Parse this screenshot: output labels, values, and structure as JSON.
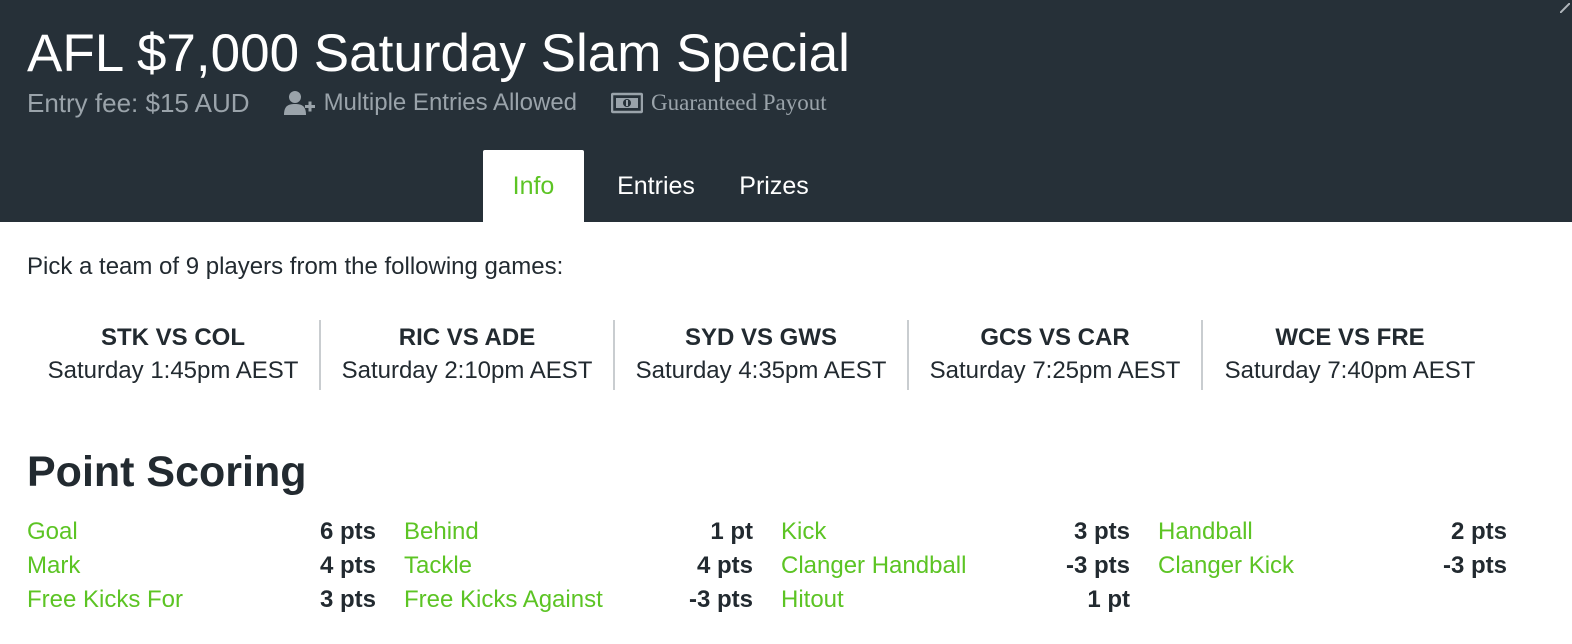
{
  "header": {
    "title": "AFL $7,000 Saturday Slam Special",
    "entry_fee": "Entry fee: $15 AUD",
    "multiple_entries": "Multiple Entries Allowed",
    "guaranteed_payout": "Guaranteed Payout",
    "icons": {
      "multiple_entries": "user-plus-icon",
      "guaranteed_payout": "money-bill-icon"
    }
  },
  "tabs": [
    {
      "label": "Info",
      "active": true
    },
    {
      "label": "Entries",
      "active": false
    },
    {
      "label": "Prizes",
      "active": false
    }
  ],
  "intro_text": "Pick a team of 9 players from the following games:",
  "games": [
    {
      "matchup": "STK VS COL",
      "time": "Saturday 1:45pm AEST"
    },
    {
      "matchup": "RIC VS ADE",
      "time": "Saturday 2:10pm AEST"
    },
    {
      "matchup": "SYD VS GWS",
      "time": "Saturday 4:35pm AEST"
    },
    {
      "matchup": "GCS VS CAR",
      "time": "Saturday 7:25pm AEST"
    },
    {
      "matchup": "WCE VS FRE",
      "time": "Saturday 7:40pm AEST"
    }
  ],
  "scoring": {
    "title": "Point Scoring",
    "items": [
      {
        "label": "Goal",
        "value": "6 pts"
      },
      {
        "label": "Behind",
        "value": "1 pt"
      },
      {
        "label": "Kick",
        "value": "3 pts"
      },
      {
        "label": "Handball",
        "value": "2 pts"
      },
      {
        "label": "Mark",
        "value": "4 pts"
      },
      {
        "label": "Tackle",
        "value": "4 pts"
      },
      {
        "label": "Clanger Handball",
        "value": "-3 pts"
      },
      {
        "label": "Clanger Kick",
        "value": "-3 pts"
      },
      {
        "label": "Free Kicks For",
        "value": "3 pts"
      },
      {
        "label": "Free Kicks Against",
        "value": "-3 pts"
      },
      {
        "label": "Hitout",
        "value": "1 pt"
      }
    ]
  },
  "colors": {
    "header_bg": "#263038",
    "accent_green": "#5cc424",
    "muted_text": "#9aa3aa",
    "body_text": "#222a30"
  }
}
